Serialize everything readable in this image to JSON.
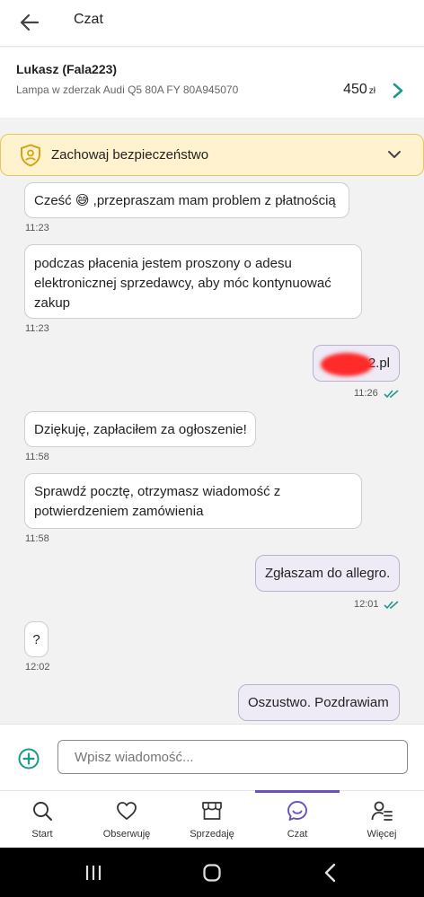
{
  "header": {
    "title": "Czat",
    "back_icon": "arrow-left-icon"
  },
  "listing": {
    "user": "Lukasz (Fala223)",
    "item": "Lampa w zderzak Audi Q5 80A FY 80A945070",
    "price": "450",
    "currency": "zł"
  },
  "safety": {
    "label": "Zachowaj bezpieczeństwo",
    "icon": "shield-user-icon",
    "accent": "#e8c65a",
    "background": "#fff3cf"
  },
  "messages": [
    {
      "text": "Cześć 😅 ,przepraszam mam problem z płatnością",
      "time": "11:23",
      "direction": "in"
    },
    {
      "line1": "podczas płacenia jestem proszony o adesu",
      "line2": "elektronicznej sprzedawcy, aby móc kontynuować",
      "line3": "zakup",
      "time": "11:23",
      "direction": "in"
    },
    {
      "text": "2.pl",
      "time": "11:26",
      "direction": "out"
    },
    {
      "text": "Dziękuję, zapłaciłem za ogłoszenie!",
      "time": "11:58",
      "direction": "in"
    },
    {
      "line1": "Sprawdź pocztę, otrzymasz wiadomość z",
      "line2": "potwierdzeniem zamówienia",
      "time": "11:58",
      "direction": "in"
    },
    {
      "text": "Zgłaszam do allegro.",
      "time": "12:01",
      "direction": "out"
    },
    {
      "text": "?",
      "time": "12:02",
      "direction": "in"
    },
    {
      "text": "Oszustwo. Pozdrawiam",
      "direction": "out"
    }
  ],
  "composer": {
    "placeholder": "Wpisz wiadomość..."
  },
  "nav": {
    "items": [
      {
        "label": "Start",
        "icon": "search-icon"
      },
      {
        "label": "Obserwuję",
        "icon": "heart-icon"
      },
      {
        "label": "Sprzedaję",
        "icon": "store-icon"
      },
      {
        "label": "Czat",
        "icon": "chat-icon",
        "active": true
      },
      {
        "label": "Więcej",
        "icon": "user-menu-icon"
      }
    ]
  },
  "colors": {
    "accent": "#6b4fbd",
    "read_ticks": "#1a9a8a",
    "chevron": "#1a9a8a"
  }
}
